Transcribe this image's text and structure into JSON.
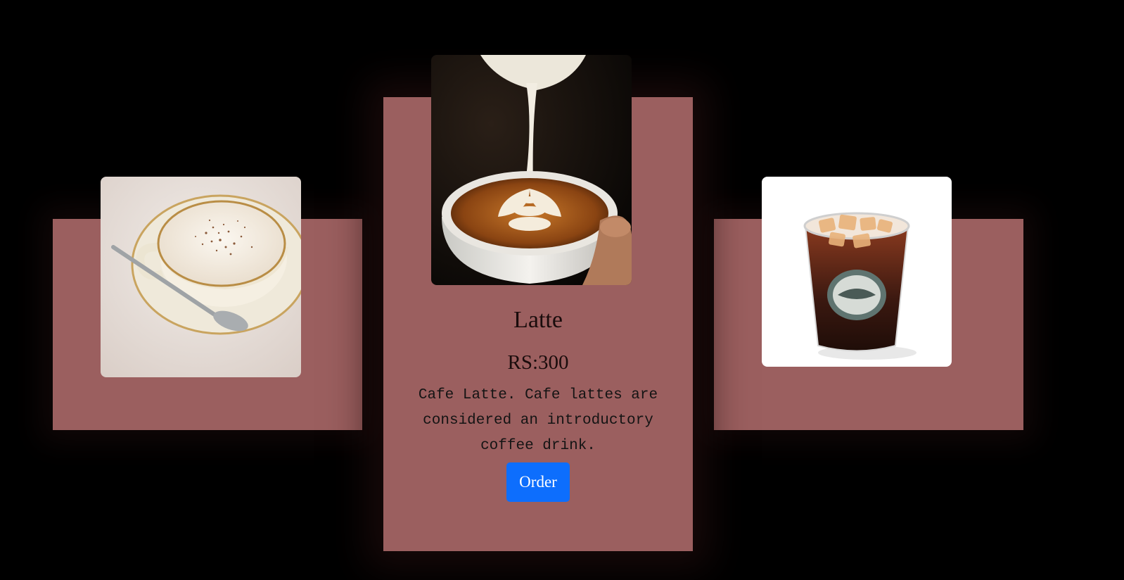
{
  "featured": {
    "title": "Latte",
    "price": "RS:300",
    "description": "Cafe Latte. Cafe lattes are considered an introductory coffee drink.",
    "order_label": "Order"
  },
  "colors": {
    "background": "#000000",
    "card": "#9b5f5f",
    "button": "#0d6efd",
    "button_text": "#ffffff"
  },
  "images": {
    "left": "cappuccino-photo",
    "middle": "latte-pour-photo",
    "right": "iced-coffee-photo"
  }
}
